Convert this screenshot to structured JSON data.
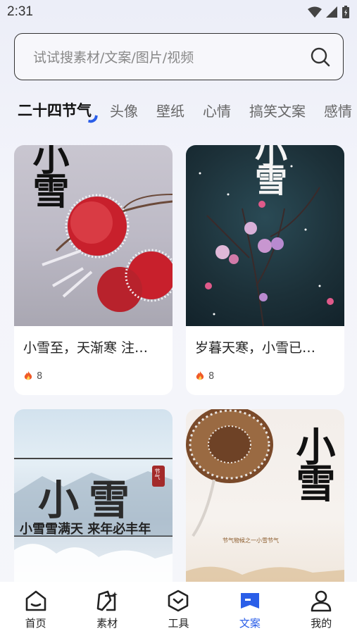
{
  "status": {
    "time": "2:31"
  },
  "search": {
    "placeholder": "试试搜素材/文案/图片/视频"
  },
  "tabs": [
    {
      "label": "二十四节气"
    },
    {
      "label": "头像"
    },
    {
      "label": "壁纸"
    },
    {
      "label": "心情"
    },
    {
      "label": "搞笑文案"
    },
    {
      "label": "感情"
    }
  ],
  "cards": [
    {
      "title": "小雪至，天渐寒 注…",
      "likes": "8",
      "image_text": "小雪"
    },
    {
      "title": "岁暮天寒，小雪已…",
      "likes": "8",
      "image_text": "小雪"
    },
    {
      "image_text": "小雪",
      "subtitle": "小雪雪满天 来年必丰年",
      "stamp": "节气"
    },
    {
      "image_text": "小雪",
      "subtitle": "节气物候之一小雪节气"
    }
  ],
  "nav": [
    {
      "label": "首页",
      "icon": "home-icon"
    },
    {
      "label": "素材",
      "icon": "material-icon"
    },
    {
      "label": "工具",
      "icon": "tools-icon"
    },
    {
      "label": "文案",
      "icon": "copywriting-icon"
    },
    {
      "label": "我的",
      "icon": "profile-icon"
    }
  ],
  "colors": {
    "accent": "#2a5ee8",
    "like": "#f05a28"
  }
}
